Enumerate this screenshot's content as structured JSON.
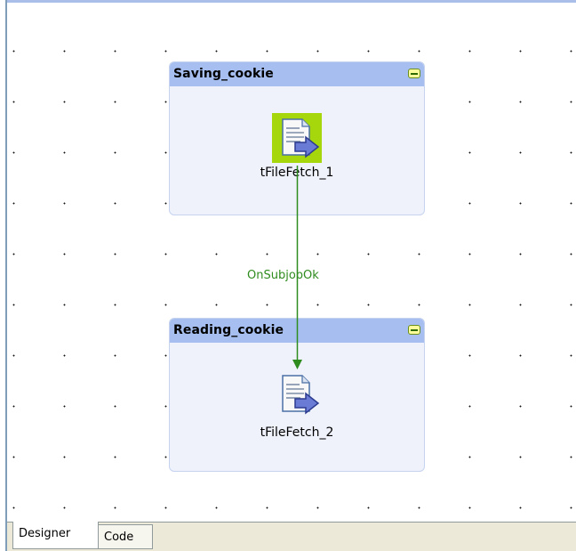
{
  "subjobs": [
    {
      "title": "Saving_cookie"
    },
    {
      "title": "Reading_cookie"
    }
  ],
  "components": [
    {
      "label": "tFileFetch_1",
      "icon": "file-fetch-icon",
      "selected": true
    },
    {
      "label": "tFileFetch_2",
      "icon": "file-fetch-icon",
      "selected": false
    }
  ],
  "connection": {
    "label": "OnSubjobOk"
  },
  "tabs": [
    {
      "label": "Designer",
      "active": true
    },
    {
      "label": "Code",
      "active": false
    }
  ],
  "colors": {
    "subjob_header": "#a7bff0",
    "subjob_body": "#eff2fb",
    "connection": "#2e8b1e",
    "selection": "#a6d60c"
  }
}
